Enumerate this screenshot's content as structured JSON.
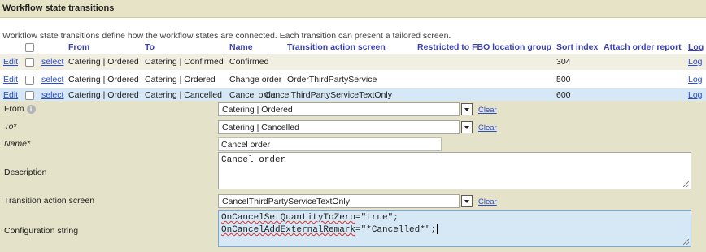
{
  "header": {
    "title": "Workflow state transitions"
  },
  "intro": "Workflow state transitions define how the workflow states are connected. Each transition can present a tailored screen.",
  "columns": {
    "from": "From",
    "to": "To",
    "name": "Name",
    "transition_action_screen": "Transition action screen",
    "restricted": "Restricted to FBO location group",
    "sort_index": "Sort index",
    "attach_order_report": "Attach order report",
    "log": "Log"
  },
  "rows": [
    {
      "edit": "Edit",
      "select": "select",
      "from": "Catering | Ordered",
      "to": "Catering | Confirmed",
      "name": "Confirmed",
      "screen": "",
      "sort_index": "304",
      "log": "Log"
    },
    {
      "edit": "Edit",
      "select": "select",
      "from": "Catering | Ordered",
      "to": "Catering | Ordered",
      "name": "Change order",
      "screen": "OrderThirdPartyService",
      "sort_index": "500",
      "log": "Log"
    },
    {
      "edit": "Edit",
      "select": "select",
      "from": "Catering | Ordered",
      "to": "Catering | Cancelled",
      "name": "Cancel order",
      "screen": "CancelThirdPartyServiceTextOnly",
      "sort_index": "600",
      "log": "Log"
    }
  ],
  "form": {
    "from": {
      "label": "From",
      "value": "Catering | Ordered",
      "clear": "Clear"
    },
    "to": {
      "label": "To*",
      "value": "Catering | Cancelled",
      "clear": "Clear"
    },
    "name": {
      "label": "Name*",
      "value": "Cancel order"
    },
    "description": {
      "label": "Description",
      "value": "Cancel order"
    },
    "screen": {
      "label": "Transition action screen",
      "value": "CancelThirdPartyServiceTextOnly",
      "clear": "Clear"
    },
    "config": {
      "label": "Configuration string",
      "line1_key": "OnCancelSetQuantityToZero",
      "line1_rest": "=\"true\";",
      "line2_key": "OnCancelAddExternalRemark",
      "line2_rest": "=\"*Cancelled*\";"
    }
  },
  "icons": {
    "info": "info-icon",
    "dropdown": "chevron-down-icon"
  }
}
